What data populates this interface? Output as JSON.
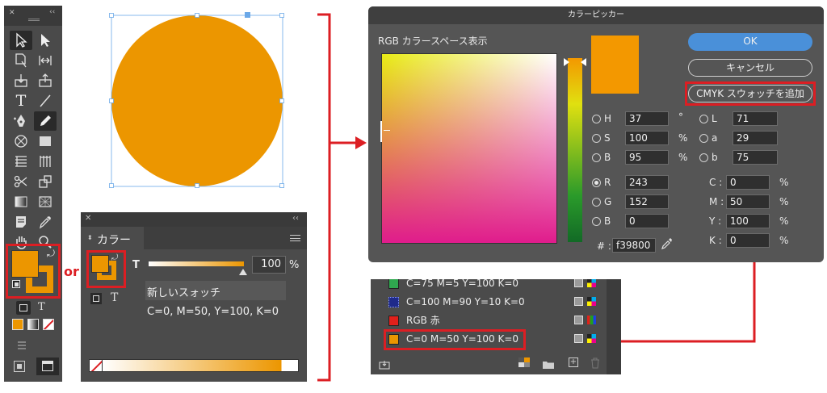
{
  "colors": {
    "fill": "#ec9600",
    "highlight": "#dc1e23",
    "ok_button": "#4a90d9"
  },
  "tools_panel": {
    "collapse_label": "‹‹",
    "close_label": "✕",
    "type_tool_glyph": "T",
    "stroke_type_glyph": "T"
  },
  "or_label": "or",
  "color_panel": {
    "close_label": "✕",
    "collapse_label": "‹‹",
    "tab_label": "カラー",
    "tint_label": "T",
    "tint_value": "100",
    "tint_unit": "%",
    "swatch_name": "新しいスォッチ",
    "cmyk_readout": "C=0, M=50, Y=100, K=0",
    "text_glyph": "T"
  },
  "color_picker": {
    "title": "カラーピッカー",
    "space_label": "RGB カラースペース表示",
    "ok": "OK",
    "cancel": "キャンセル",
    "add_cmyk": "CMYK スウォッチを追加",
    "hsb": [
      {
        "label": "H",
        "value": "37",
        "unit": "°"
      },
      {
        "label": "S",
        "value": "100",
        "unit": "%"
      },
      {
        "label": "B",
        "value": "95",
        "unit": "%"
      }
    ],
    "lab": [
      {
        "label": "L",
        "value": "71"
      },
      {
        "label": "a",
        "value": "29"
      },
      {
        "label": "b",
        "value": "75"
      }
    ],
    "rgb": [
      {
        "label": "R",
        "value": "243"
      },
      {
        "label": "G",
        "value": "152"
      },
      {
        "label": "B",
        "value": "0"
      }
    ],
    "cmyk": [
      {
        "label": "C",
        "value": "0",
        "unit": "%"
      },
      {
        "label": "M",
        "value": "50",
        "unit": "%"
      },
      {
        "label": "Y",
        "value": "100",
        "unit": "%"
      },
      {
        "label": "K",
        "value": "0",
        "unit": "%"
      }
    ],
    "hex_label": "#",
    "hex_value": "f39800"
  },
  "swatches": {
    "items": [
      {
        "name": "C=75 M=5 Y=100 K=0",
        "color": "#2fa84f"
      },
      {
        "name": "C=100 M=90 Y=10 K=0",
        "color": "#1f2a8a"
      },
      {
        "name": "RGB 赤",
        "color": "#e0201b"
      },
      {
        "name": "C=0 M=50 Y=100 K=0",
        "color": "#ec9600"
      }
    ]
  }
}
